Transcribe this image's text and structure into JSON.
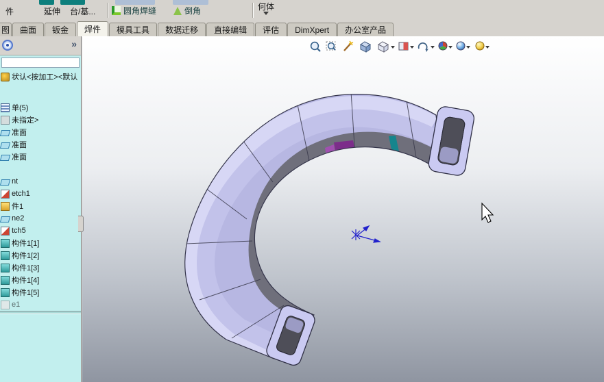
{
  "colors": {
    "model_body": "#c6c6ee",
    "model_face_dark": "#6f6f7b",
    "segment_purple": "#7c2d8a",
    "segment_teal": "#15858d",
    "panel_bg": "#c2efee",
    "toolbar_bg": "#d6d3ce"
  },
  "top_toolbar": {
    "buttons": [
      {
        "label": "件"
      },
      {
        "label": "延伸"
      },
      {
        "label": "台/基..."
      },
      {
        "label": "圆角焊缝"
      },
      {
        "label": "倒角"
      },
      {
        "label": "何体"
      }
    ]
  },
  "tabs": {
    "items": [
      {
        "label": "图",
        "cls": "cropped"
      },
      {
        "label": "曲面"
      },
      {
        "label": "钣金"
      },
      {
        "label": "焊件",
        "cls": "active"
      },
      {
        "label": "模具工具"
      },
      {
        "label": "数据迁移"
      },
      {
        "label": "直接编辑"
      },
      {
        "label": "评估"
      },
      {
        "label": "DimXpert"
      },
      {
        "label": "办公室产品"
      }
    ]
  },
  "feature_tree": {
    "collapse_chevron": "»",
    "rows": [
      {
        "label": "状认<按加工><默认",
        "icon": "ic-config",
        "cls": "first"
      },
      {
        "label": "单(5)",
        "icon": "ic-list",
        "cls": "gap-a"
      },
      {
        "label": "未指定>",
        "icon": "ic-grey"
      },
      {
        "label": "准面",
        "icon": "ic-plane"
      },
      {
        "label": "准面",
        "icon": "ic-plane"
      },
      {
        "label": "准面",
        "icon": "ic-plane"
      },
      {
        "label": "nt",
        "icon": "ic-plane",
        "cls": "gap-b"
      },
      {
        "label": "etch1",
        "icon": "ic-sketch"
      },
      {
        "label": "件1",
        "icon": "ic-part"
      },
      {
        "label": "ne2",
        "icon": "ic-plane"
      },
      {
        "label": "tch5",
        "icon": "ic-sketch"
      },
      {
        "label": "构件1[1]",
        "icon": "ic-member"
      },
      {
        "label": "构件1[2]",
        "icon": "ic-member"
      },
      {
        "label": "构件1[3]",
        "icon": "ic-member"
      },
      {
        "label": "构件1[4]",
        "icon": "ic-member"
      },
      {
        "label": "构件1[5]",
        "icon": "ic-member"
      }
    ],
    "footer_label": "e1"
  },
  "viewport": {
    "toolbar_icons": [
      "zoom-to-fit",
      "zoom-to-area",
      "magnified-selection",
      "view-orientation",
      "display-style",
      "section-view",
      "rotate-view",
      "edit-appearance",
      "apply-scene",
      "view-settings"
    ]
  }
}
